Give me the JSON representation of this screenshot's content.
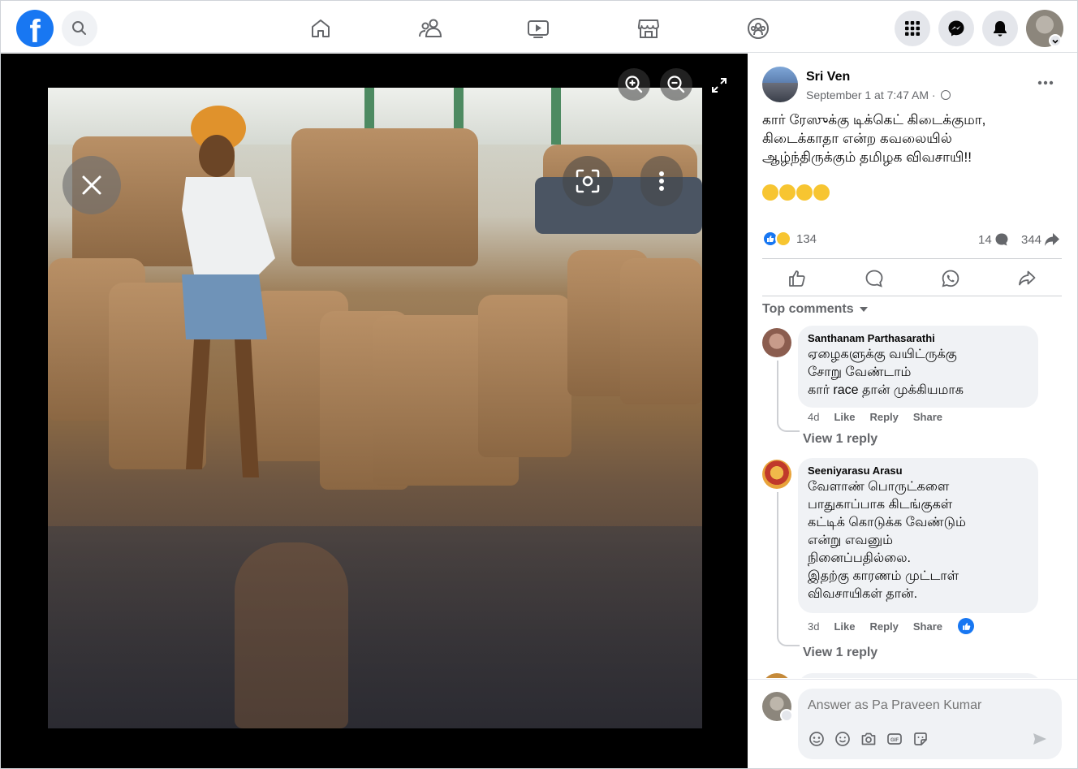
{
  "topbar": {
    "logo_letter": "f",
    "nav": [
      "home-icon",
      "friends-icon",
      "watch-icon",
      "marketplace-icon",
      "groups-icon"
    ],
    "right": [
      "menu-grid-icon",
      "messenger-icon",
      "bell-icon"
    ]
  },
  "post": {
    "author": "Sri Ven",
    "time": "September 1 at 7:47 AM · ",
    "text": "கார் ரேஸுக்கு டிக்கெட் கிடைக்குமா,\nகிடைக்காதா என்ற கவலையில்\nஆழ்ந்திருக்கும் தமிழக விவசாயி!!",
    "reaction_count": "134",
    "comment_count": "14",
    "share_count": "344"
  },
  "comments_header": "Top comments",
  "comments": [
    {
      "name": "Santhanam Parthasarathi",
      "text": "ஏழைகளுக்கு வயிட்ருக்கு\nசோறு வேண்டாம்\nகார் race தான் முக்கியமாக",
      "time": "4d",
      "like": "Like",
      "reply": "Reply",
      "share": "Share",
      "view_reply": "View 1 reply"
    },
    {
      "name": "Seeniyarasu Arasu",
      "text": "வேளாண் பொருட்களை\nபாதுகாப்பாக கிடங்குகள்\nகட்டிக் கொடுக்க வேண்டும்\nஎன்று எவனும்\nநினைப்பதில்லை.\nஇதற்கு காரணம் முட்டாள்\nவிவசாயிகள் தான்.",
      "time": "3d",
      "like": "Like",
      "reply": "Reply",
      "share": "Share",
      "view_reply": "View 1 reply"
    }
  ],
  "reply_box": {
    "placeholder": "Answer as Pa Praveen Kumar"
  },
  "colors": {
    "brand": "#1877f2",
    "muted": "#65676b",
    "bubble": "#f0f2f5"
  }
}
